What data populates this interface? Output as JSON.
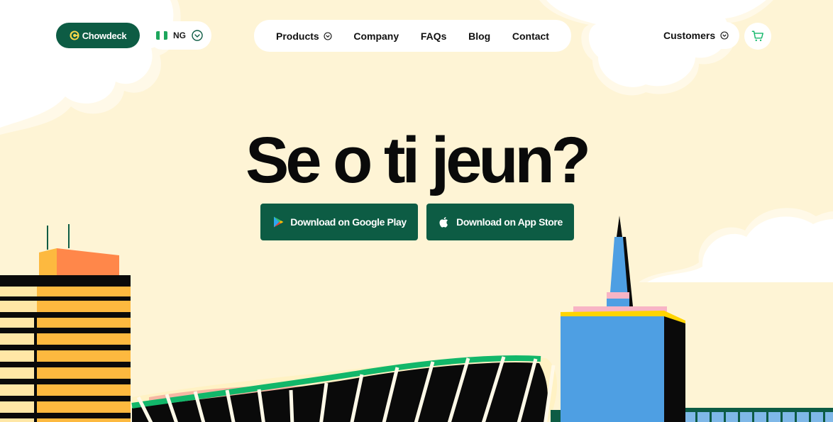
{
  "brand": {
    "name": "Chowdeck"
  },
  "country": {
    "code": "NG"
  },
  "nav": {
    "items": [
      {
        "label": "Products",
        "has_dropdown": true
      },
      {
        "label": "Company",
        "has_dropdown": false
      },
      {
        "label": "FAQs",
        "has_dropdown": false
      },
      {
        "label": "Blog",
        "has_dropdown": false
      },
      {
        "label": "Contact",
        "has_dropdown": false
      }
    ]
  },
  "customers": {
    "label": "Customers"
  },
  "hero": {
    "headline": "Se o ti jeun?",
    "google_play_label": "Download on Google Play",
    "app_store_label": "Download on App Store"
  },
  "colors": {
    "background": "#FEF4D5",
    "brand_green": "#0D5C44",
    "accent_green": "#12B76A",
    "cloud": "#FFFFFF",
    "building_yellow": "#FDB93F",
    "building_orange": "#FF874A",
    "tower_blue": "#4E9FE3",
    "pink": "#F8B4C5"
  },
  "icons": {
    "logo": "chowdeck-logo-icon",
    "flag": "nigeria-flag-icon",
    "chevron": "chevron-down-icon",
    "cart": "cart-icon",
    "google_play": "google-play-icon",
    "apple": "apple-icon"
  }
}
